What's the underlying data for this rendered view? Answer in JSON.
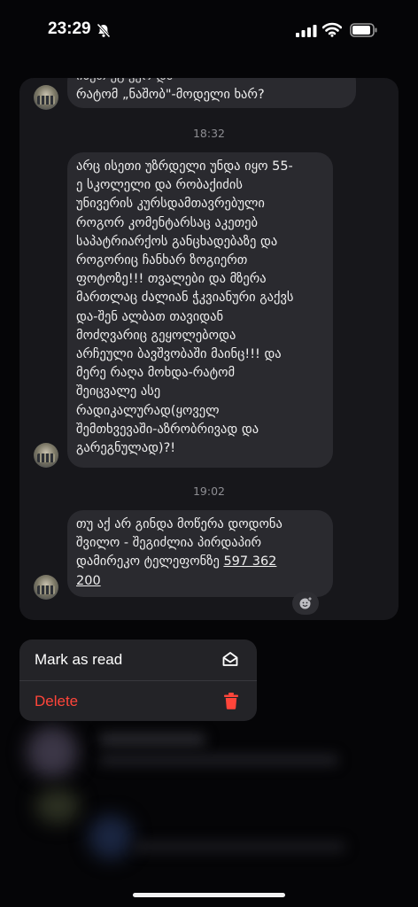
{
  "status_bar": {
    "time": "23:29"
  },
  "messages": [
    {
      "lines": [
        "ისეთ ეგ ვერ და",
        "რატომ „ნაშობ\"-მოდელი ხარ?"
      ]
    },
    {
      "timestamp": "18:32"
    },
    {
      "lines": [
        "არც ისეთი უზრდელი უნდა იყო 55-",
        "ე სკოლელი და რობაქიძის",
        "უნივერის კურსდამთავრებული",
        "როგორ კომენტარსაც აკეთებ",
        "საპატრიარქოს განცხადებაზე და",
        "როგორიც ჩანხარ ზოგიერთ",
        "ფოტოზე!!! თვალები და მზერა",
        "მართლაც ძალიან ჭკვიანური გაქვს",
        "და-შენ ალბათ თავიდან",
        "მოძღვარიც გეყოლებოდა",
        "არჩეული ბავშვობაში მაინც!!! და",
        "მერე რაღა მოხდა-რატომ",
        "შეიცვალე ასე",
        "რადიკალურად(ყოველ",
        "შემთხვევაში-აზრობრივად და",
        "გარეგნულად)?!"
      ]
    },
    {
      "timestamp": "19:02"
    },
    {
      "lines": [
        "თუ აქ არ გინდა მოწერა დოდონა",
        "შვილო - შეგიძლია პირდაპირ"
      ],
      "last_line_prefix": "დამირეკო ტელეფონზე ",
      "phone_a": "597 362",
      "phone_b": "200"
    }
  ],
  "context_menu": {
    "items": [
      {
        "label": "Mark as read",
        "icon": "envelope-open-icon",
        "color": "#ffffff"
      },
      {
        "label": "Delete",
        "icon": "trash-icon",
        "color": "#ff453a"
      }
    ]
  },
  "colors": {
    "accent_danger": "#ff453a",
    "bubble": "#2a2a2f",
    "panel": "#17171b"
  }
}
